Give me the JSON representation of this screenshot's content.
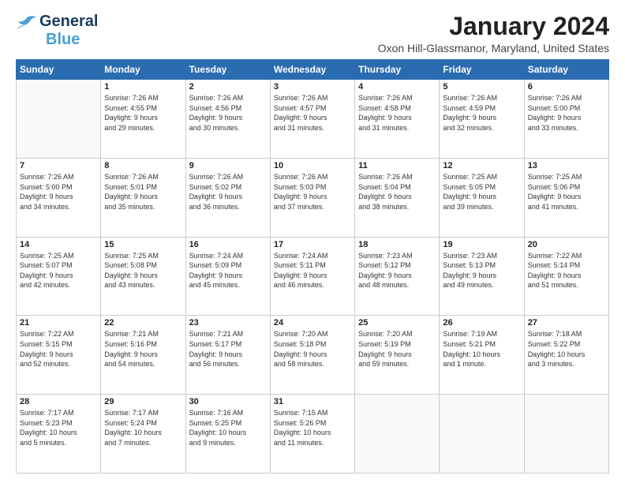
{
  "logo": {
    "line1": "General",
    "line2": "Blue"
  },
  "title": "January 2024",
  "location": "Oxon Hill-Glassmanor, Maryland, United States",
  "days_of_week": [
    "Sunday",
    "Monday",
    "Tuesday",
    "Wednesday",
    "Thursday",
    "Friday",
    "Saturday"
  ],
  "weeks": [
    [
      {
        "day": "",
        "info": ""
      },
      {
        "day": "1",
        "info": "Sunrise: 7:26 AM\nSunset: 4:55 PM\nDaylight: 9 hours\nand 29 minutes."
      },
      {
        "day": "2",
        "info": "Sunrise: 7:26 AM\nSunset: 4:56 PM\nDaylight: 9 hours\nand 30 minutes."
      },
      {
        "day": "3",
        "info": "Sunrise: 7:26 AM\nSunset: 4:57 PM\nDaylight: 9 hours\nand 31 minutes."
      },
      {
        "day": "4",
        "info": "Sunrise: 7:26 AM\nSunset: 4:58 PM\nDaylight: 9 hours\nand 31 minutes."
      },
      {
        "day": "5",
        "info": "Sunrise: 7:26 AM\nSunset: 4:59 PM\nDaylight: 9 hours\nand 32 minutes."
      },
      {
        "day": "6",
        "info": "Sunrise: 7:26 AM\nSunset: 5:00 PM\nDaylight: 9 hours\nand 33 minutes."
      }
    ],
    [
      {
        "day": "7",
        "info": "Sunrise: 7:26 AM\nSunset: 5:00 PM\nDaylight: 9 hours\nand 34 minutes."
      },
      {
        "day": "8",
        "info": "Sunrise: 7:26 AM\nSunset: 5:01 PM\nDaylight: 9 hours\nand 35 minutes."
      },
      {
        "day": "9",
        "info": "Sunrise: 7:26 AM\nSunset: 5:02 PM\nDaylight: 9 hours\nand 36 minutes."
      },
      {
        "day": "10",
        "info": "Sunrise: 7:26 AM\nSunset: 5:03 PM\nDaylight: 9 hours\nand 37 minutes."
      },
      {
        "day": "11",
        "info": "Sunrise: 7:26 AM\nSunset: 5:04 PM\nDaylight: 9 hours\nand 38 minutes."
      },
      {
        "day": "12",
        "info": "Sunrise: 7:25 AM\nSunset: 5:05 PM\nDaylight: 9 hours\nand 39 minutes."
      },
      {
        "day": "13",
        "info": "Sunrise: 7:25 AM\nSunset: 5:06 PM\nDaylight: 9 hours\nand 41 minutes."
      }
    ],
    [
      {
        "day": "14",
        "info": "Sunrise: 7:25 AM\nSunset: 5:07 PM\nDaylight: 9 hours\nand 42 minutes."
      },
      {
        "day": "15",
        "info": "Sunrise: 7:25 AM\nSunset: 5:08 PM\nDaylight: 9 hours\nand 43 minutes."
      },
      {
        "day": "16",
        "info": "Sunrise: 7:24 AM\nSunset: 5:09 PM\nDaylight: 9 hours\nand 45 minutes."
      },
      {
        "day": "17",
        "info": "Sunrise: 7:24 AM\nSunset: 5:11 PM\nDaylight: 9 hours\nand 46 minutes."
      },
      {
        "day": "18",
        "info": "Sunrise: 7:23 AM\nSunset: 5:12 PM\nDaylight: 9 hours\nand 48 minutes."
      },
      {
        "day": "19",
        "info": "Sunrise: 7:23 AM\nSunset: 5:13 PM\nDaylight: 9 hours\nand 49 minutes."
      },
      {
        "day": "20",
        "info": "Sunrise: 7:22 AM\nSunset: 5:14 PM\nDaylight: 9 hours\nand 51 minutes."
      }
    ],
    [
      {
        "day": "21",
        "info": "Sunrise: 7:22 AM\nSunset: 5:15 PM\nDaylight: 9 hours\nand 52 minutes."
      },
      {
        "day": "22",
        "info": "Sunrise: 7:21 AM\nSunset: 5:16 PM\nDaylight: 9 hours\nand 54 minutes."
      },
      {
        "day": "23",
        "info": "Sunrise: 7:21 AM\nSunset: 5:17 PM\nDaylight: 9 hours\nand 56 minutes."
      },
      {
        "day": "24",
        "info": "Sunrise: 7:20 AM\nSunset: 5:18 PM\nDaylight: 9 hours\nand 58 minutes."
      },
      {
        "day": "25",
        "info": "Sunrise: 7:20 AM\nSunset: 5:19 PM\nDaylight: 9 hours\nand 59 minutes."
      },
      {
        "day": "26",
        "info": "Sunrise: 7:19 AM\nSunset: 5:21 PM\nDaylight: 10 hours\nand 1 minute."
      },
      {
        "day": "27",
        "info": "Sunrise: 7:18 AM\nSunset: 5:22 PM\nDaylight: 10 hours\nand 3 minutes."
      }
    ],
    [
      {
        "day": "28",
        "info": "Sunrise: 7:17 AM\nSunset: 5:23 PM\nDaylight: 10 hours\nand 5 minutes."
      },
      {
        "day": "29",
        "info": "Sunrise: 7:17 AM\nSunset: 5:24 PM\nDaylight: 10 hours\nand 7 minutes."
      },
      {
        "day": "30",
        "info": "Sunrise: 7:16 AM\nSunset: 5:25 PM\nDaylight: 10 hours\nand 9 minutes."
      },
      {
        "day": "31",
        "info": "Sunrise: 7:15 AM\nSunset: 5:26 PM\nDaylight: 10 hours\nand 11 minutes."
      },
      {
        "day": "",
        "info": ""
      },
      {
        "day": "",
        "info": ""
      },
      {
        "day": "",
        "info": ""
      }
    ]
  ]
}
